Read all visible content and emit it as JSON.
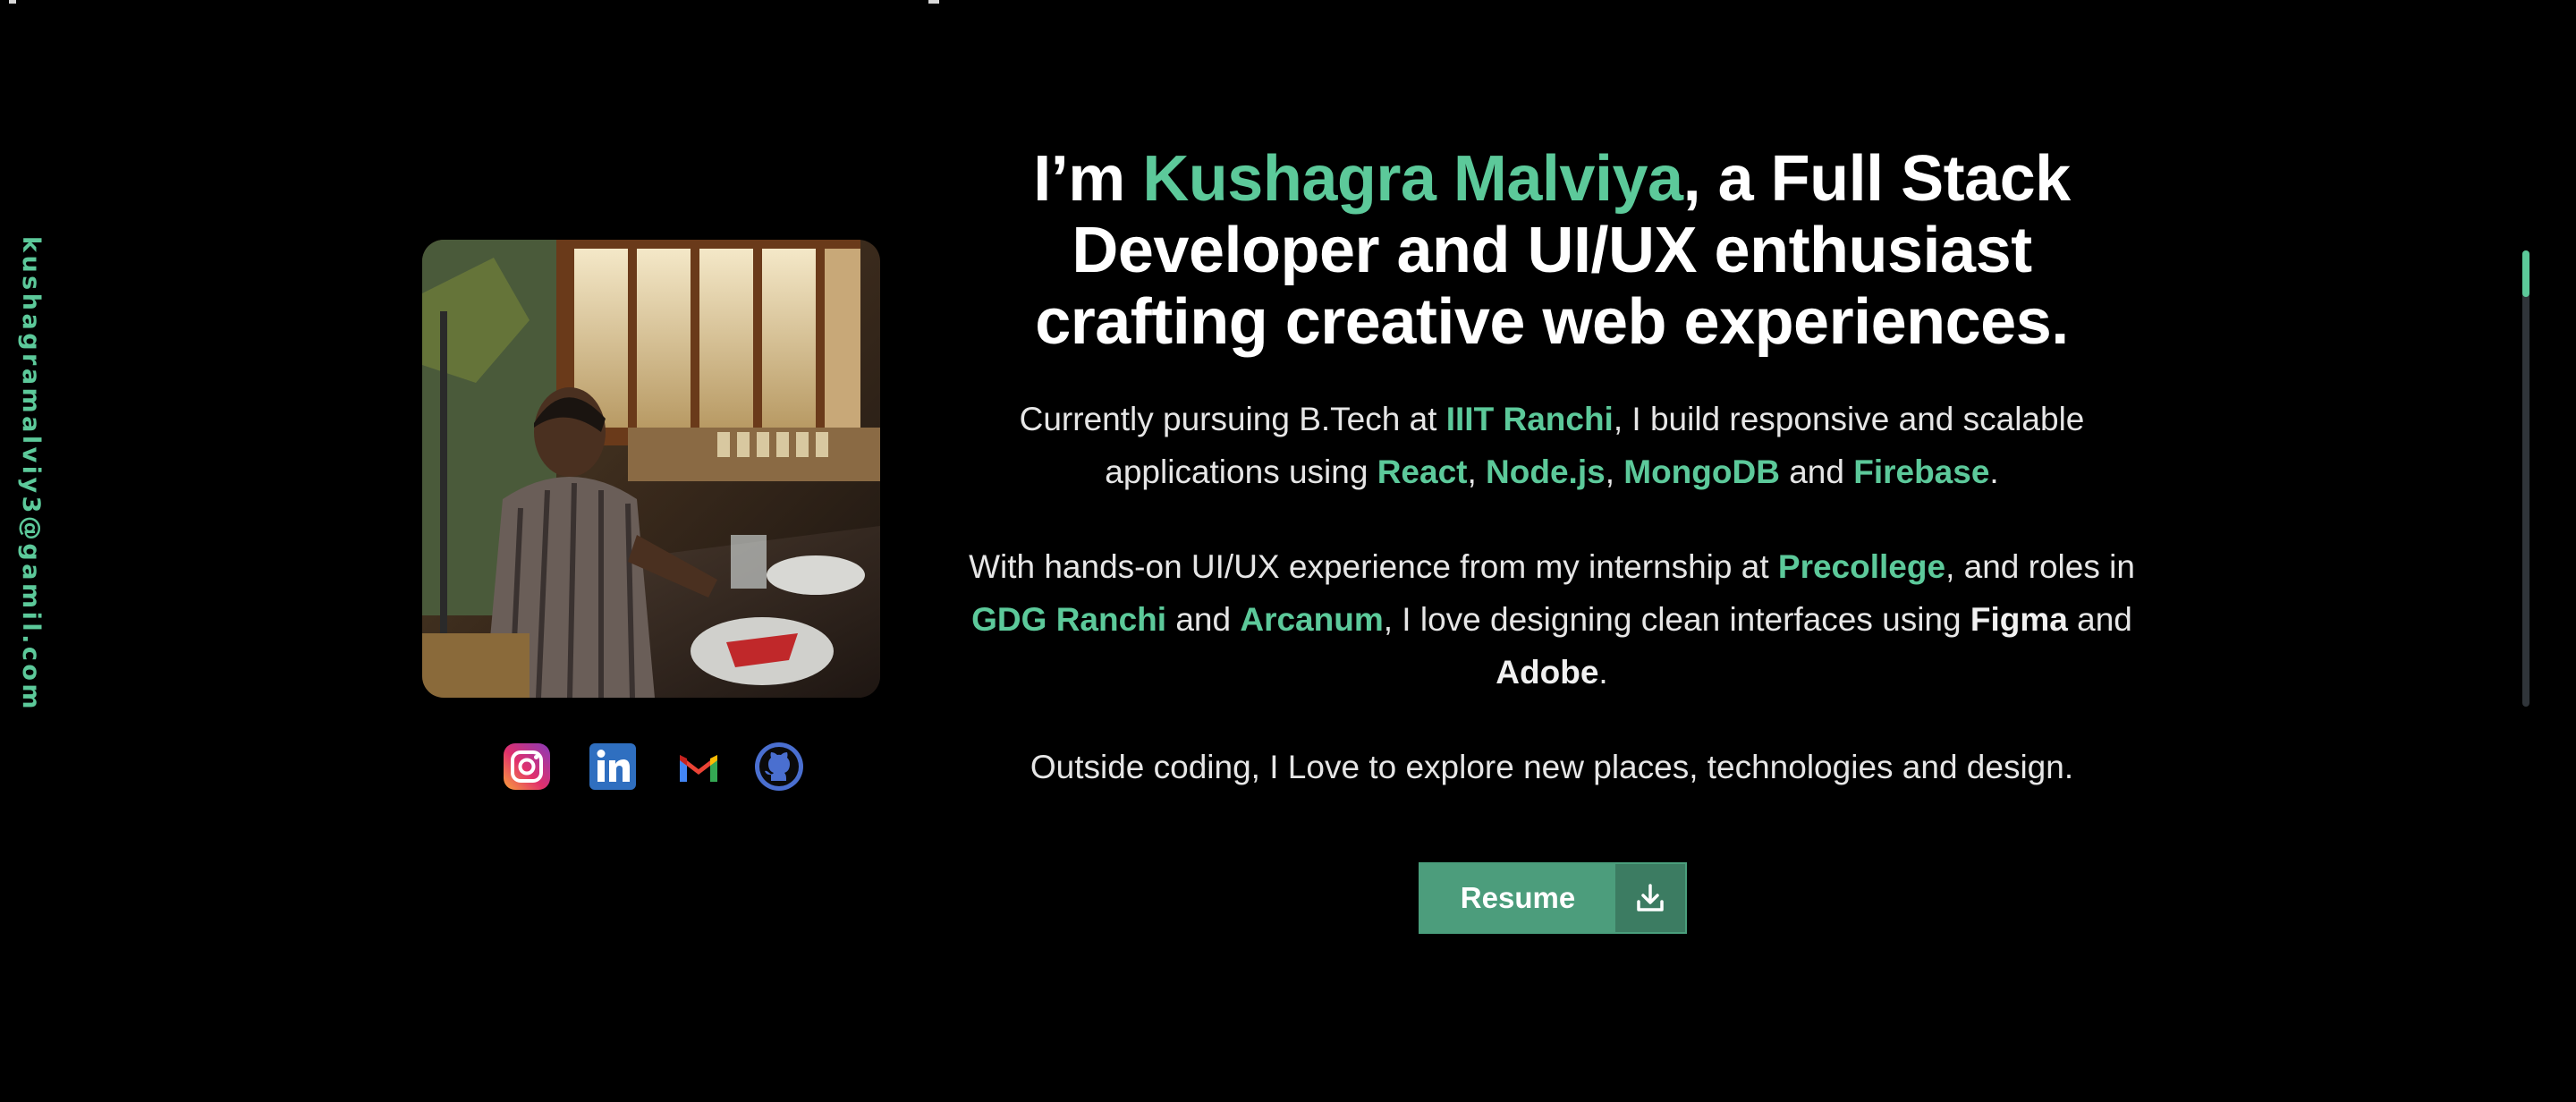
{
  "sidebar": {
    "email": "kushagramalviy3@gamil.com"
  },
  "profile": {
    "photo_alt": "Kushagra Malviya"
  },
  "social": [
    {
      "icon": "instagram-icon"
    },
    {
      "icon": "linkedin-icon"
    },
    {
      "icon": "gmail-icon"
    },
    {
      "icon": "github-icon"
    }
  ],
  "hero": {
    "headline_prefix": "I’m ",
    "name": "Kushagra Malviya",
    "headline_suffix": ", a Full Stack Developer and UI/UX enthusiast crafting creative web experiences."
  },
  "p1": {
    "t1": "Currently pursuing B.Tech at ",
    "college": "IIIT Ranchi",
    "t2": ", I build responsive and scalable applications using ",
    "react": "React",
    "c1": ", ",
    "node": "Node.js",
    "c2": ", ",
    "mongo": "MongoDB",
    "and": " and ",
    "firebase": "Firebase",
    "end": "."
  },
  "p2": {
    "t1": "With hands-on UI/UX experience from my internship at ",
    "precollege": "Precollege",
    "t2": ", and roles in ",
    "gdg": "GDG Ranchi",
    "and1": " and ",
    "arcanum": "Arcanum",
    "t3": ", I love designing clean interfaces using ",
    "figma": "Figma",
    "and2": " and ",
    "adobe": "Adobe",
    "end": "."
  },
  "p3": {
    "text": "Outside coding, I Love to explore new places, technologies and design."
  },
  "resume": {
    "label": "Resume",
    "icon": "download-icon"
  },
  "colors": {
    "accent": "#5cc99a",
    "button": "#4c9d7c",
    "button_icon_bg": "#3c7c62",
    "background": "#000000"
  }
}
